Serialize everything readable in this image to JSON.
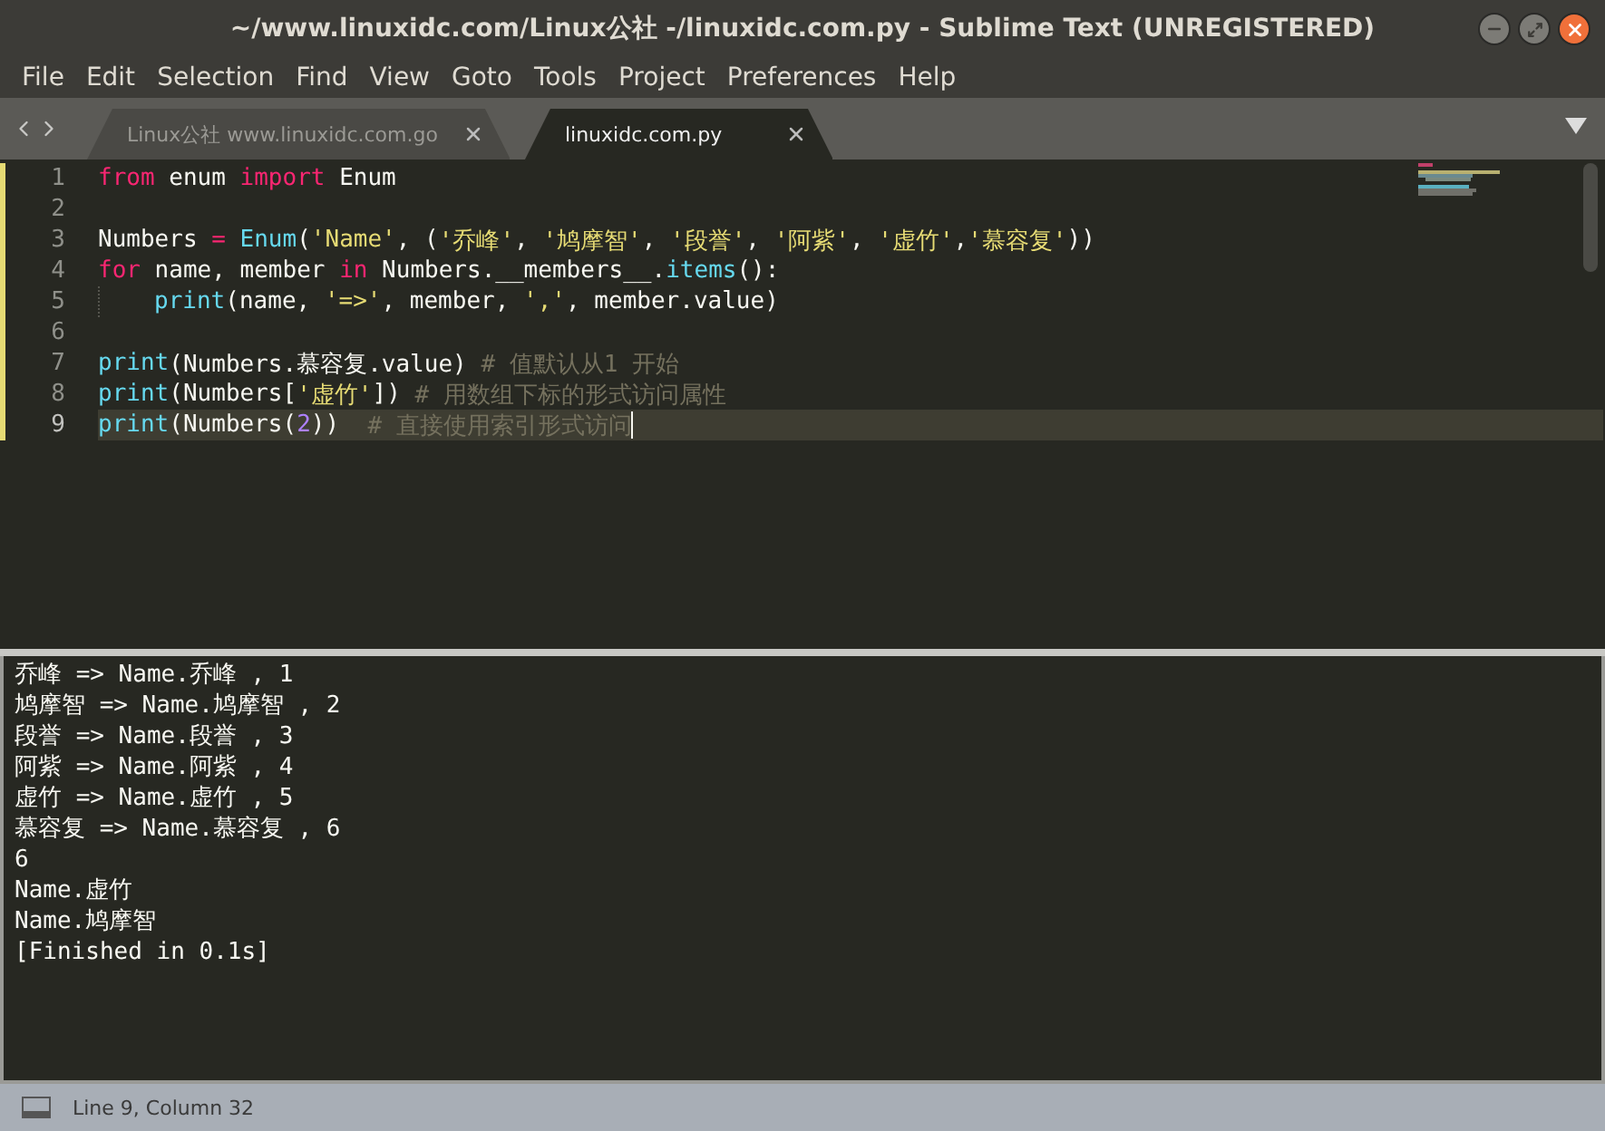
{
  "window": {
    "title": "~/www.linuxidc.com/Linux公社 -/linuxidc.com.py - Sublime Text (UNREGISTERED)"
  },
  "menu": [
    "File",
    "Edit",
    "Selection",
    "Find",
    "View",
    "Goto",
    "Tools",
    "Project",
    "Preferences",
    "Help"
  ],
  "tabs": [
    {
      "label": "Linux公社 www.linuxidc.com.go",
      "selected": false
    },
    {
      "label": "linuxidc.com.py",
      "selected": true
    }
  ],
  "editor": {
    "lines": [
      {
        "number": "1",
        "modified": true,
        "current": false,
        "tokens": [
          {
            "kind": "keyword",
            "text": "from"
          },
          {
            "kind": "plain",
            "text": " enum "
          },
          {
            "kind": "keyword",
            "text": "import"
          },
          {
            "kind": "plain",
            "text": " Enum"
          }
        ]
      },
      {
        "number": "2",
        "modified": true,
        "current": false
      },
      {
        "number": "3",
        "modified": true,
        "current": false,
        "tokens": [
          {
            "kind": "plain",
            "text": "Numbers "
          },
          {
            "kind": "keyword",
            "text": "="
          },
          {
            "kind": "builtin",
            "text": " Enum"
          },
          {
            "kind": "plain",
            "text": "("
          },
          {
            "kind": "string",
            "text": "'Name'"
          },
          {
            "kind": "plain",
            "text": ", ("
          },
          {
            "kind": "string",
            "text": "'乔峰'"
          },
          {
            "kind": "plain",
            "text": ", "
          },
          {
            "kind": "string",
            "text": "'鸠摩智'"
          },
          {
            "kind": "plain",
            "text": ", "
          },
          {
            "kind": "string",
            "text": "'段誉'"
          },
          {
            "kind": "plain",
            "text": ", "
          },
          {
            "kind": "string",
            "text": "'阿紫'"
          },
          {
            "kind": "plain",
            "text": ", "
          },
          {
            "kind": "string",
            "text": "'虚竹'"
          },
          {
            "kind": "plain",
            "text": ","
          },
          {
            "kind": "string",
            "text": "'慕容复'"
          },
          {
            "kind": "plain",
            "text": "))"
          }
        ]
      },
      {
        "number": "4",
        "modified": true,
        "current": false,
        "tokens": [
          {
            "kind": "keyword",
            "text": "for"
          },
          {
            "kind": "plain",
            "text": " name, member "
          },
          {
            "kind": "keyword",
            "text": "in"
          },
          {
            "kind": "plain",
            "text": " Numbers.__members__."
          },
          {
            "kind": "builtin",
            "text": "items"
          },
          {
            "kind": "plain",
            "text": "():"
          }
        ]
      },
      {
        "number": "5",
        "modified": true,
        "current": false,
        "indented": true,
        "tokens": [
          {
            "kind": "builtin",
            "text": "print"
          },
          {
            "kind": "plain",
            "text": "(name, "
          },
          {
            "kind": "string",
            "text": "'=>'"
          },
          {
            "kind": "plain",
            "text": ", member, "
          },
          {
            "kind": "string",
            "text": "','"
          },
          {
            "kind": "plain",
            "text": ", member.value)"
          }
        ]
      },
      {
        "number": "6",
        "modified": true,
        "current": false
      },
      {
        "number": "7",
        "modified": true,
        "current": false,
        "tokens": [
          {
            "kind": "builtin",
            "text": "print"
          },
          {
            "kind": "plain",
            "text": "(Numbers.慕容复.value) "
          },
          {
            "kind": "comment",
            "text": "# 值默认从1 开始"
          }
        ]
      },
      {
        "number": "8",
        "modified": true,
        "current": false,
        "tokens": [
          {
            "kind": "builtin",
            "text": "print"
          },
          {
            "kind": "plain",
            "text": "(Numbers["
          },
          {
            "kind": "string",
            "text": "'虚竹'"
          },
          {
            "kind": "plain",
            "text": "]) "
          },
          {
            "kind": "comment",
            "text": "# 用数组下标的形式访问属性"
          }
        ]
      },
      {
        "number": "9",
        "modified": true,
        "current": true,
        "tokens": [
          {
            "kind": "builtin",
            "text": "print"
          },
          {
            "kind": "plain",
            "text": "(Numbers("
          },
          {
            "kind": "number",
            "text": "2"
          },
          {
            "kind": "plain",
            "text": "))  "
          },
          {
            "kind": "comment",
            "text": "# 直接使用索引形式访问"
          }
        ]
      }
    ]
  },
  "output": [
    "乔峰 => Name.乔峰 , 1",
    "鸠摩智 => Name.鸠摩智 , 2",
    "段誉 => Name.段誉 , 3",
    "阿紫 => Name.阿紫 , 4",
    "虚竹 => Name.虚竹 , 5",
    "慕容复 => Name.慕容复 , 6",
    "6",
    "Name.虚竹",
    "Name.鸠摩智",
    "[Finished in 0.1s]"
  ],
  "status_bar": {
    "position": "Line 9, Column 32"
  }
}
